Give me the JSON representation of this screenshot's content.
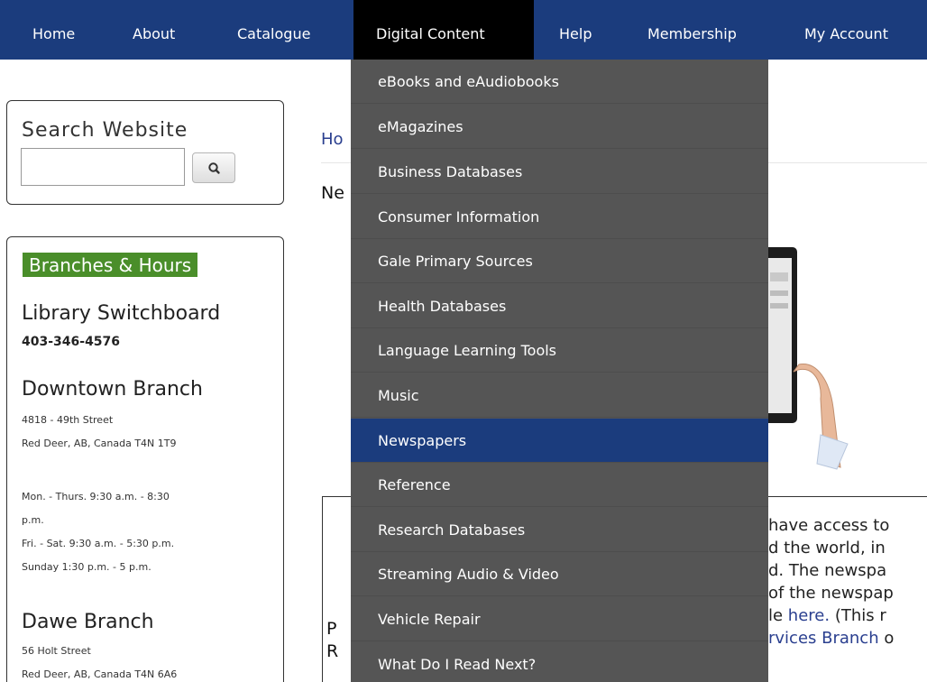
{
  "nav": {
    "items": [
      "Home",
      "About",
      "Catalogue",
      "Digital Content",
      "Help",
      "Membership",
      "My Account"
    ],
    "active": "Digital Content"
  },
  "dropdown": {
    "items": [
      "eBooks and eAudiobooks",
      "eMagazines",
      "Business Databases",
      "Consumer Information",
      "Gale Primary Sources",
      "Health Databases",
      "Language Learning Tools",
      "Music",
      "Newspapers",
      "Reference",
      "Research Databases",
      "Streaming Audio & Video",
      "Vehicle Repair",
      "What Do I Read Next?"
    ],
    "active": "Newspapers"
  },
  "search": {
    "title": "Search Website",
    "value": "",
    "placeholder": "",
    "icon": "search-icon"
  },
  "branches": {
    "badge": "Branches & Hours",
    "switchboard_title": "Library Switchboard",
    "switchboard_phone": "403-346-4576",
    "downtown": {
      "name": "Downtown Branch",
      "address1": "4818 - 49th Street",
      "address2": "Red Deer, AB, Canada T4N 1T9",
      "hours": [
        "Mon. - Thurs. 9:30 a.m. - 8:30",
        "p.m.",
        "Fri. - Sat. 9:30 a.m. - 5:30 p.m.",
        "Sunday 1:30 p.m. - 5 p.m."
      ]
    },
    "dawe": {
      "name": "Dawe Branch",
      "address1": "56 Holt Street",
      "address2": "Red Deer, AB, Canada T4N 6A6"
    }
  },
  "main": {
    "breadcrumb_visible": "Ho",
    "title_visible": "Ne",
    "left_letters": [
      "P",
      "R"
    ],
    "info_lines": [
      {
        "text": "have access to"
      },
      {
        "text": "d the world, in"
      },
      {
        "text": "d. The newspa"
      },
      {
        "text": "of the newspap"
      },
      {
        "pre": "le ",
        "link": "here.",
        "post": " (This r"
      },
      {
        "link": "rvices Branch",
        "post": " o"
      }
    ]
  },
  "colors": {
    "nav_bg": "#1b3c7d",
    "nav_active_bg": "#000000",
    "dropdown_bg": "#555555",
    "dropdown_active_bg": "#1b3c7d",
    "badge_bg": "#4a8e2a",
    "link": "#2a3f8f"
  }
}
